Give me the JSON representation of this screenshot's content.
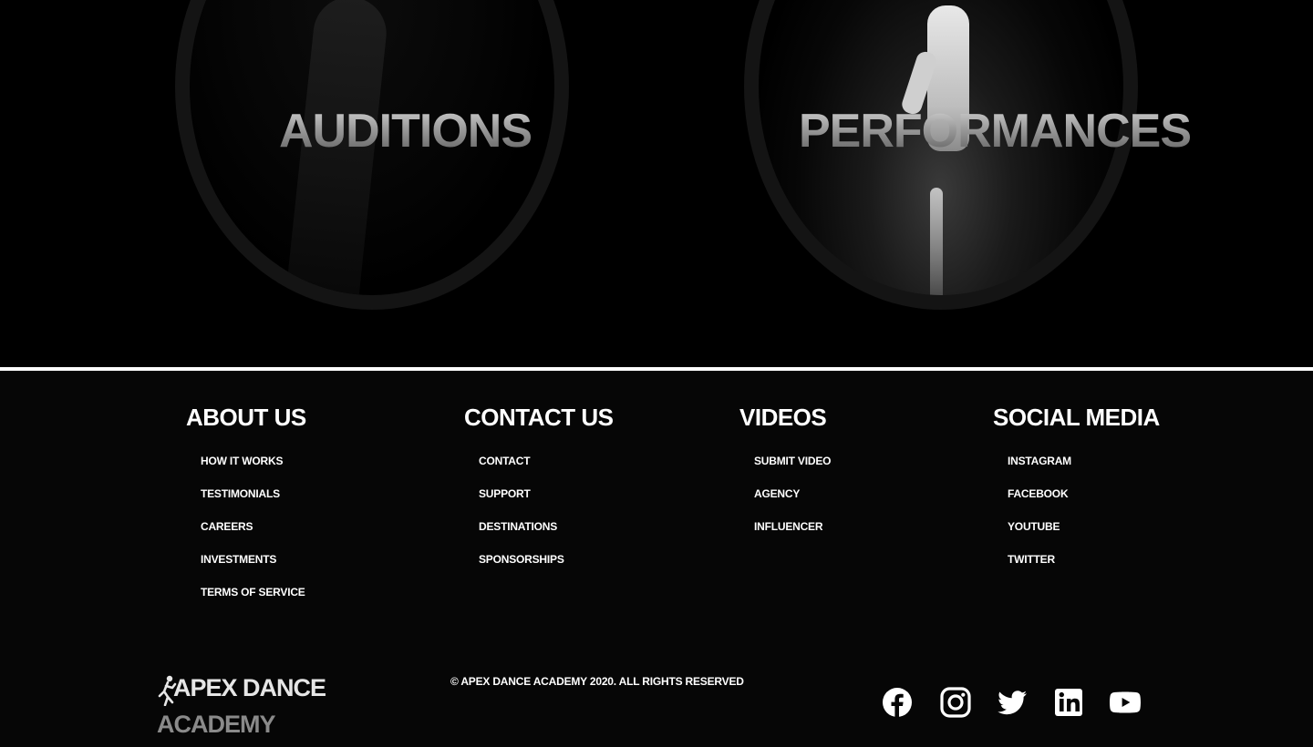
{
  "hero": {
    "cards": [
      {
        "title": "Auditions"
      },
      {
        "title": "Performances"
      }
    ]
  },
  "footer": {
    "columns": [
      {
        "heading": "About Us",
        "links": [
          "How It Works",
          "Testimonials",
          "Careers",
          "Investments",
          "Terms of Service"
        ]
      },
      {
        "heading": "Contact Us",
        "links": [
          "Contact",
          "Support",
          "Destinations",
          "Sponsorships"
        ]
      },
      {
        "heading": "Videos",
        "links": [
          "Submit Video",
          "Agency",
          "Influencer"
        ]
      },
      {
        "heading": "Social Media",
        "links": [
          "Instagram",
          "Facebook",
          "YouTube",
          "Twitter"
        ]
      }
    ],
    "logo": {
      "line1": "APEX DANCE",
      "line2": "ACADEMY"
    },
    "copyright": "© APEX DANCE ACADEMY 2020. ALL RIGHTS RESERVED",
    "social_icons": [
      "facebook-icon",
      "instagram-icon",
      "twitter-icon",
      "linkedin-icon",
      "youtube-icon"
    ]
  }
}
